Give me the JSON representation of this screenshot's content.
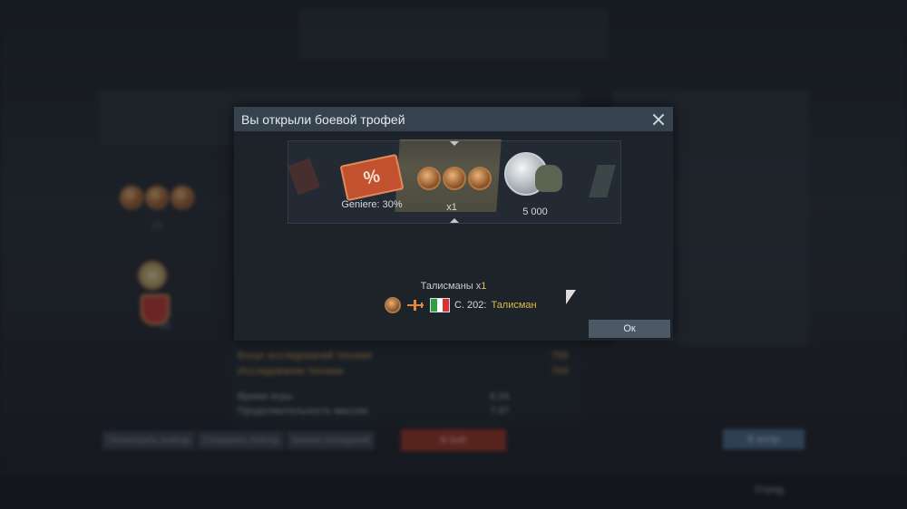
{
  "dialog": {
    "title": "Вы открыли боевой трофей",
    "reel": {
      "discount_label": "Geniere: 30%",
      "discount_percent_icon": "%",
      "talismans_count": "x1",
      "silver_amount": "5 000",
      "silver_icon": "silver-lion-icon"
    },
    "rewards": {
      "talisman_label": "Талисманы x",
      "talisman_count": "1",
      "vehicle_name": "C. 202:",
      "vehicle_tag": "Талисман",
      "flag_colors": [
        "#2f9e44",
        "#ffffff",
        "#d6333b"
      ]
    },
    "ok_label": "Ок"
  },
  "background": {
    "medals_count": "x1",
    "badge_count": "x5",
    "buttons": {
      "replay": "Посмотреть повтор",
      "save_replay": "Сохранить повтор",
      "hit_analysis": "Анализ попаданий",
      "to_battle": "В бой!",
      "to_hangar": "В ангар"
    },
    "stats": [
      {
        "label": "Время игры",
        "value": "6:24"
      },
      {
        "label": "Продолжительность миссии",
        "value": "7:47"
      }
    ],
    "research": [
      {
        "label": "Бонус исследований техники",
        "value": "759"
      },
      {
        "label": "Исследование техники",
        "value": "764"
      }
    ],
    "footer_label": "Отряд"
  }
}
